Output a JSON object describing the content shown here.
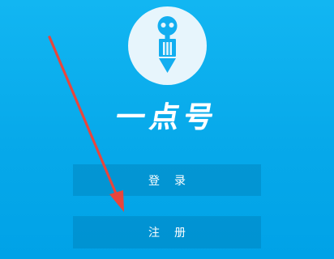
{
  "app": {
    "brand_name": "一点号",
    "logo_icon": "pencil-robot-icon"
  },
  "actions": {
    "login_label": "登录",
    "register_label": "注册"
  },
  "annotation": {
    "icon": "red-arrow-icon",
    "color": "#e8453c"
  },
  "colors": {
    "background_top": "#12b6f2",
    "background_bottom": "#00a2e7",
    "logo_circle": "#e7f5fc",
    "logo_figure": "#12aef0",
    "button_fill": "rgba(0,120,175,0.38)",
    "text": "#ffffff"
  }
}
